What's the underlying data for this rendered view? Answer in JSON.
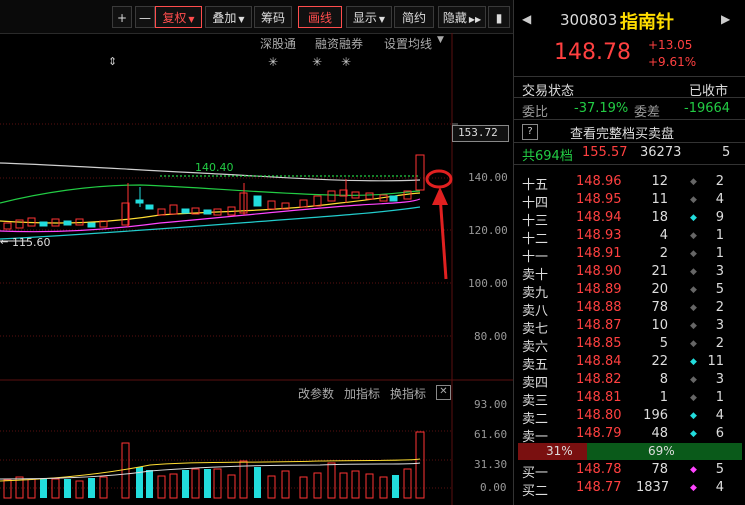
{
  "toolbar": {
    "items": [
      {
        "label": "+"
      },
      {
        "label": "—"
      },
      {
        "label": "复权"
      },
      {
        "label": "叠加"
      },
      {
        "label": "筹码"
      },
      {
        "label": "画线"
      },
      {
        "label": "显示"
      },
      {
        "label": "简约"
      },
      {
        "label": "隐藏"
      }
    ]
  },
  "chart_header": {
    "shenguantong": "深股通",
    "rongzirongquan": "融资融券",
    "set_ma": "设置均线"
  },
  "price_axis": {
    "current_price_tag": "153.72",
    "ticks": [
      "140.00",
      "120.00",
      "100.00",
      "80.00"
    ]
  },
  "annotations": {
    "high_label": "140.40",
    "low_label": "115.60"
  },
  "sub_chart": {
    "buttons": [
      "改参数",
      "加指标",
      "换指标"
    ],
    "ticks": [
      "93.00",
      "61.60",
      "31.30",
      "0.00"
    ]
  },
  "stock": {
    "code": "300803",
    "name": "指南针",
    "price": "148.78",
    "change": "+13.05",
    "change_pct": "+9.61%"
  },
  "status": {
    "label": "交易状态",
    "value": "已收市"
  },
  "ratios": {
    "weibi_label": "委比",
    "weibi": "-37.19%",
    "weicha_label": "委差",
    "weicha": "-19664"
  },
  "full_book": {
    "help": "?",
    "label": "查看完整档买卖盘"
  },
  "total": {
    "label": "共694档",
    "price": "155.57",
    "volume": "36273",
    "count": "5"
  },
  "asks": [
    {
      "level": "十五",
      "price": "148.96",
      "vol": "12",
      "mark": "◆",
      "mark_color": "#666666",
      "count": "2"
    },
    {
      "level": "十四",
      "price": "148.95",
      "vol": "11",
      "mark": "◆",
      "mark_color": "#666666",
      "count": "4"
    },
    {
      "level": "十三",
      "price": "148.94",
      "vol": "18",
      "mark": "◆",
      "mark_color": "#22dddd",
      "count": "9"
    },
    {
      "level": "十二",
      "price": "148.93",
      "vol": "4",
      "mark": "◆",
      "mark_color": "#666666",
      "count": "1"
    },
    {
      "level": "十一",
      "price": "148.91",
      "vol": "2",
      "mark": "◆",
      "mark_color": "#666666",
      "count": "1"
    },
    {
      "level": "卖十",
      "price": "148.90",
      "vol": "21",
      "mark": "◆",
      "mark_color": "#666666",
      "count": "3"
    },
    {
      "level": "卖九",
      "price": "148.89",
      "vol": "20",
      "mark": "◆",
      "mark_color": "#666666",
      "count": "5"
    },
    {
      "level": "卖八",
      "price": "148.88",
      "vol": "78",
      "mark": "◆",
      "mark_color": "#666666",
      "count": "2"
    },
    {
      "level": "卖七",
      "price": "148.87",
      "vol": "10",
      "mark": "◆",
      "mark_color": "#666666",
      "count": "3"
    },
    {
      "level": "卖六",
      "price": "148.85",
      "vol": "5",
      "mark": "◆",
      "mark_color": "#666666",
      "count": "2"
    },
    {
      "level": "卖五",
      "price": "148.84",
      "vol": "22",
      "mark": "◆",
      "mark_color": "#22dddd",
      "count": "11"
    },
    {
      "level": "卖四",
      "price": "148.82",
      "vol": "8",
      "mark": "◆",
      "mark_color": "#666666",
      "count": "3"
    },
    {
      "level": "卖三",
      "price": "148.81",
      "vol": "1",
      "mark": "◆",
      "mark_color": "#666666",
      "count": "1"
    },
    {
      "level": "卖二",
      "price": "148.80",
      "vol": "196",
      "mark": "◆",
      "mark_color": "#22dddd",
      "count": "4"
    },
    {
      "level": "卖一",
      "price": "148.79",
      "vol": "48",
      "mark": "◆",
      "mark_color": "#22dddd",
      "count": "6"
    }
  ],
  "ratio_bar": {
    "sell_pct": "31%",
    "buy_pct": "69%",
    "sell_fraction": 0.31
  },
  "bids": [
    {
      "level": "买一",
      "price": "148.78",
      "vol": "78",
      "mark": "◆",
      "mark_color": "#ff44ff",
      "count": "5"
    },
    {
      "level": "买二",
      "price": "148.77",
      "vol": "1837",
      "mark": "◆",
      "mark_color": "#ff44ff",
      "count": "4"
    }
  ]
}
